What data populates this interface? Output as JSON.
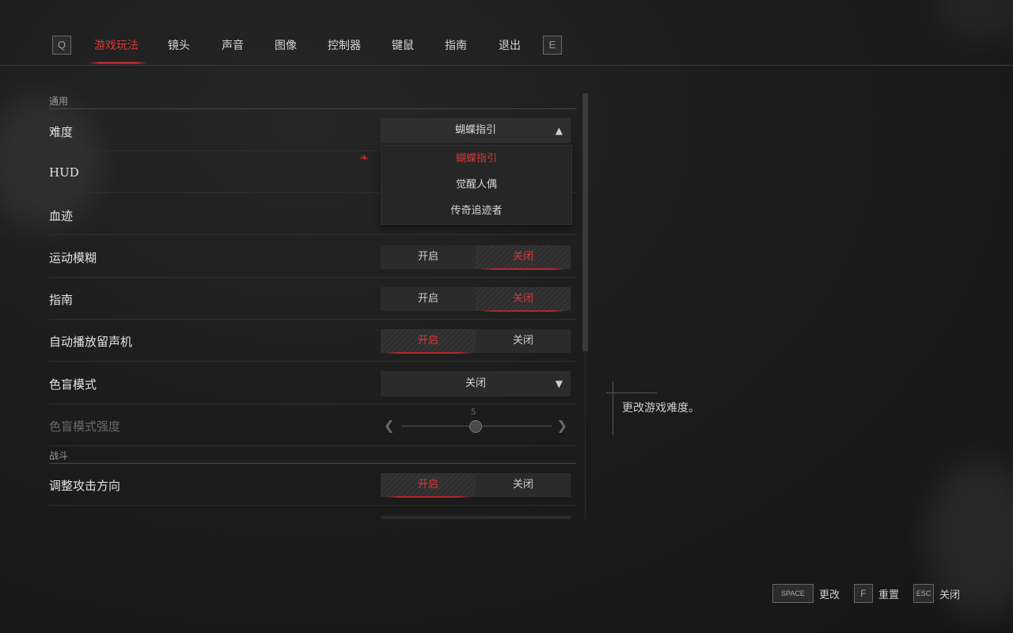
{
  "nav": {
    "prev_key": "Q",
    "next_key": "E",
    "tabs": [
      {
        "label": "游戏玩法",
        "active": true
      },
      {
        "label": "镜头"
      },
      {
        "label": "声音"
      },
      {
        "label": "图像"
      },
      {
        "label": "控制器"
      },
      {
        "label": "键鼠"
      },
      {
        "label": "指南"
      },
      {
        "label": "退出"
      }
    ]
  },
  "sections": {
    "general": "通用",
    "combat": "战斗"
  },
  "settings": {
    "difficulty": {
      "label": "难度",
      "value": "蝴蝶指引",
      "options": [
        "蝴蝶指引",
        "觉醒人偶",
        "传奇追迹者"
      ]
    },
    "hud": {
      "label": "HUD"
    },
    "blood": {
      "label": "血迹"
    },
    "motion_blur": {
      "label": "运动模糊",
      "on": "开启",
      "off": "关闭",
      "selected": "off"
    },
    "guide": {
      "label": "指南",
      "on": "开启",
      "off": "关闭",
      "selected": "off"
    },
    "autoplay": {
      "label": "自动播放留声机",
      "on": "开启",
      "off": "关闭",
      "selected": "on"
    },
    "colorblind": {
      "label": "色盲模式",
      "value": "关闭"
    },
    "colorblind_strength": {
      "label": "色盲模式强度",
      "value": "5"
    },
    "attack_direction": {
      "label": "调整攻击方向",
      "on": "开启",
      "off": "关闭",
      "selected": "on"
    }
  },
  "description": "更改游戏难度。",
  "hints": [
    {
      "key": "SPACE",
      "label": "更改"
    },
    {
      "key": "F",
      "label": "重置"
    },
    {
      "key": "ESC",
      "label": "关闭"
    }
  ],
  "colors": {
    "accent": "#d8383a",
    "background": "#1c1c1c"
  }
}
